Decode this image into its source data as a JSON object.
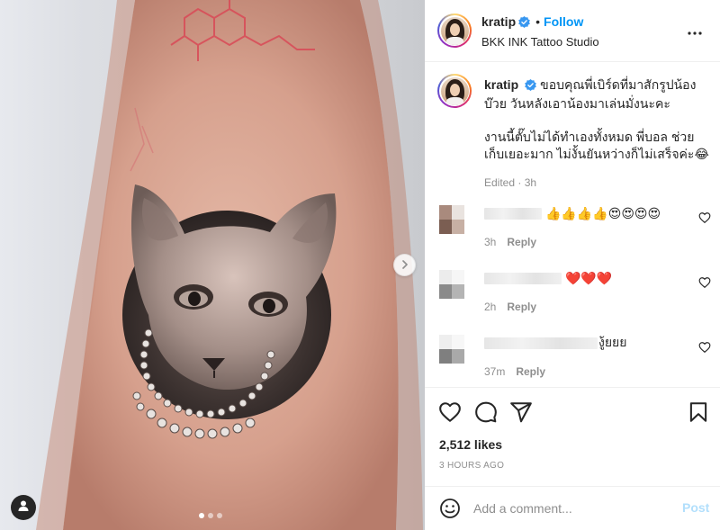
{
  "post": {
    "username": "kratip",
    "follow_label": "Follow",
    "location": "BKK INK Tattoo Studio",
    "bullet": "•"
  },
  "caption": {
    "username": "kratip",
    "line1": "ขอบคุณพี่เบิร์ดที่มาสักรูปน้อง",
    "line2": "บ๊วย วันหลังเอาน้องมาเล่นมั่งนะคะ",
    "para2_line1": "งานนี้ตั๊บไม่ได้ทำเองทั้งหมด พี่บอล ช่วย",
    "para2_line2": "เก็บเยอะมาก ไม่งั้นยันหว่างก็ไม่เสร็จค่ะ😂",
    "edited": "Edited · 3h"
  },
  "comments": [
    {
      "text": "👍👍👍👍😍😍😍😍",
      "time": "3h",
      "reply": "Reply"
    },
    {
      "text": "❤️❤️❤️",
      "time": "2h",
      "reply": "Reply"
    },
    {
      "text": "งู้ยยย",
      "time": "37m",
      "reply": "Reply"
    }
  ],
  "likes": "2,512 likes",
  "timestamp": "3 HOURS AGO",
  "add_comment": {
    "placeholder": "Add a comment...",
    "post_label": "Post"
  },
  "colors": {
    "accent": "#0095f6",
    "post_disabled": "#b2dffc",
    "text_secondary": "#8e8e8e",
    "divider": "#efefef"
  },
  "icons": {
    "verified": "verified-badge-icon",
    "more": "more-horizontal-icon",
    "next": "chevron-right-icon",
    "user_tag": "user-tag-icon",
    "like": "heart-icon",
    "comment": "comment-icon",
    "share": "share-icon",
    "save": "bookmark-icon",
    "emoji": "emoji-icon"
  },
  "carousel": {
    "slides": 3,
    "active": 1
  }
}
